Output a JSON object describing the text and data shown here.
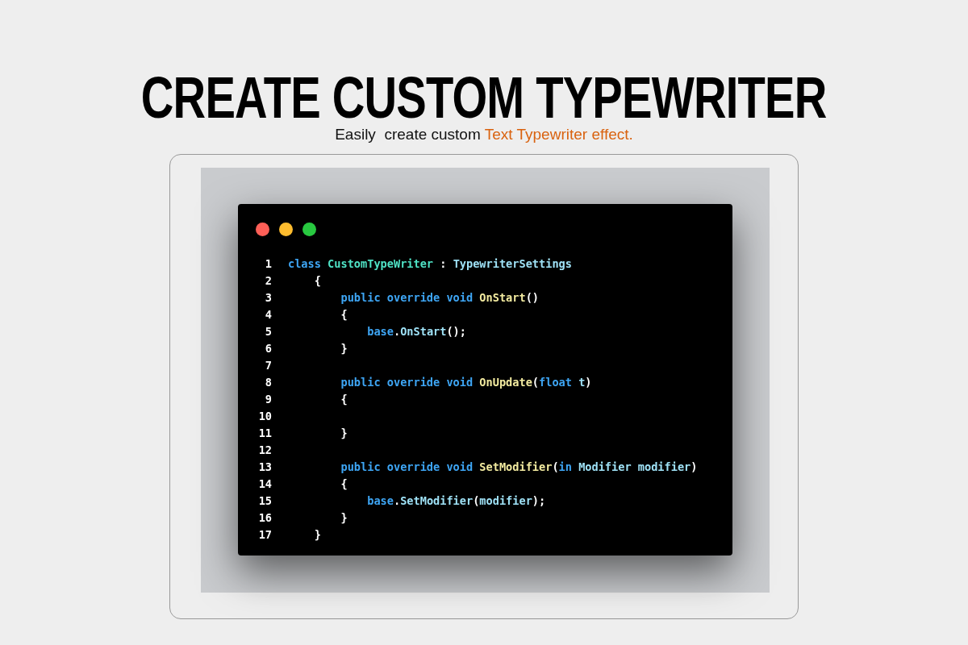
{
  "title": "CREATE CUSTOM TYPEWRITER",
  "subtitle": {
    "text": "Easily  create custom",
    "highlight": "Text Typewriter effect."
  },
  "code_window": {
    "lines": [
      {
        "number": "1",
        "tokens": [
          {
            "kind": "keyword",
            "text": "class "
          },
          {
            "kind": "class",
            "text": "CustomTypeWriter"
          },
          {
            "kind": "plain",
            "text": " : "
          },
          {
            "kind": "type",
            "text": "TypewriterSettings"
          }
        ]
      },
      {
        "number": "2",
        "tokens": [
          {
            "kind": "plain",
            "text": "    {"
          }
        ]
      },
      {
        "number": "3",
        "tokens": [
          {
            "kind": "keyword",
            "text": "        public override void "
          },
          {
            "kind": "method",
            "text": "OnStart"
          },
          {
            "kind": "plain",
            "text": "()"
          }
        ]
      },
      {
        "number": "4",
        "tokens": [
          {
            "kind": "plain",
            "text": "        {"
          }
        ]
      },
      {
        "number": "5",
        "tokens": [
          {
            "kind": "keyword",
            "text": "            base"
          },
          {
            "kind": "plain",
            "text": "."
          },
          {
            "kind": "type",
            "text": "OnStart"
          },
          {
            "kind": "plain",
            "text": "();"
          }
        ]
      },
      {
        "number": "6",
        "tokens": [
          {
            "kind": "plain",
            "text": "        }"
          }
        ]
      },
      {
        "number": "7"
      },
      {
        "number": "8",
        "tokens": [
          {
            "kind": "keyword",
            "text": "        public override void "
          },
          {
            "kind": "method",
            "text": "OnUpdate"
          },
          {
            "kind": "plain",
            "text": "("
          },
          {
            "kind": "keyword",
            "text": "float "
          },
          {
            "kind": "type",
            "text": "t"
          },
          {
            "kind": "plain",
            "text": ")"
          }
        ]
      },
      {
        "number": "9",
        "tokens": [
          {
            "kind": "plain",
            "text": "        {"
          }
        ]
      },
      {
        "number": "10"
      },
      {
        "number": "11",
        "tokens": [
          {
            "kind": "plain",
            "text": "        }"
          }
        ]
      },
      {
        "number": "12"
      },
      {
        "number": "13",
        "tokens": [
          {
            "kind": "keyword",
            "text": "        public override void "
          },
          {
            "kind": "method",
            "text": "SetModifier"
          },
          {
            "kind": "plain",
            "text": "("
          },
          {
            "kind": "keyword",
            "text": "in "
          },
          {
            "kind": "type",
            "text": "Modifier modifier"
          },
          {
            "kind": "plain",
            "text": ")"
          }
        ]
      },
      {
        "number": "14",
        "tokens": [
          {
            "kind": "plain",
            "text": "        {"
          }
        ]
      },
      {
        "number": "15",
        "tokens": [
          {
            "kind": "keyword",
            "text": "            base"
          },
          {
            "kind": "plain",
            "text": "."
          },
          {
            "kind": "type",
            "text": "SetModifier"
          },
          {
            "kind": "plain",
            "text": "("
          },
          {
            "kind": "type",
            "text": "modifier"
          },
          {
            "kind": "plain",
            "text": ");"
          }
        ]
      },
      {
        "number": "16",
        "tokens": [
          {
            "kind": "plain",
            "text": "        }"
          }
        ]
      },
      {
        "number": "17",
        "tokens": [
          {
            "kind": "plain",
            "text": "    }"
          }
        ]
      }
    ]
  }
}
